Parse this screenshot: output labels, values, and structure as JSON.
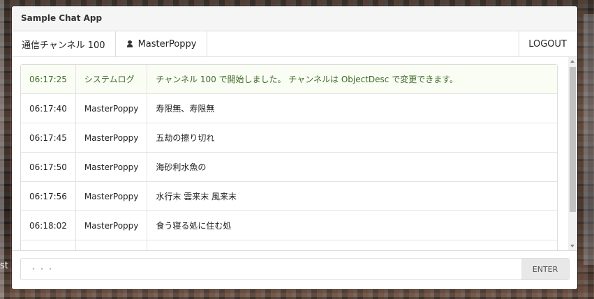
{
  "window": {
    "title": "Sample Chat App"
  },
  "menubar": {
    "channel_label": "通信チャンネル 100",
    "user_icon": "user-icon",
    "username": "MasterPoppy",
    "logout_label": "LOGOUT"
  },
  "messages": [
    {
      "time": "06:17:25",
      "sender": "システムログ",
      "text": "チャンネル 100 で開始しました。 チャンネルは ObjectDesc で変更できます。",
      "type": "system"
    },
    {
      "time": "06:17:40",
      "sender": "MasterPoppy",
      "text": "寿限無、寿限無",
      "type": "user"
    },
    {
      "time": "06:17:45",
      "sender": "MasterPoppy",
      "text": "五劫の擦り切れ",
      "type": "user"
    },
    {
      "time": "06:17:50",
      "sender": "MasterPoppy",
      "text": "海砂利水魚の",
      "type": "user"
    },
    {
      "time": "06:17:56",
      "sender": "MasterPoppy",
      "text": "水行末 雲来末 風来末",
      "type": "user"
    },
    {
      "time": "06:18:02",
      "sender": "MasterPoppy",
      "text": "食う寝る処に住む処",
      "type": "user"
    },
    {
      "time": "",
      "sender": "",
      "text": "",
      "type": "user"
    }
  ],
  "composer": {
    "placeholder": "・・・",
    "enter_label": "ENTER"
  },
  "background": {
    "fragment_text": "st"
  },
  "colors": {
    "system_text": "#3e6b2a",
    "system_bg": "#fafdf4",
    "border": "#dcdcdc",
    "button_bg": "#e8e8e8"
  }
}
